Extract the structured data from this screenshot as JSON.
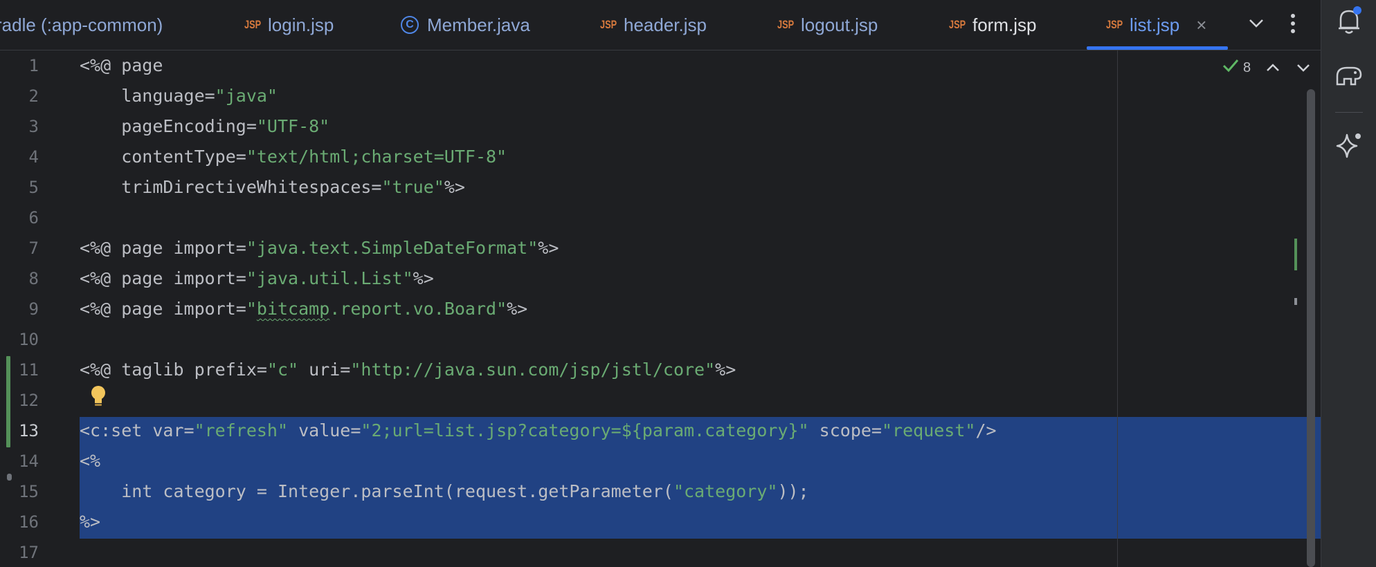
{
  "tabs": [
    {
      "name": "tab-app-common",
      "icon": "none",
      "label": "radle (:app-common)",
      "active": false
    },
    {
      "name": "tab-login-jsp",
      "icon": "jsp-file-icon",
      "label": "login.jsp",
      "active": false
    },
    {
      "name": "tab-member-java",
      "icon": "java-class-icon",
      "label": "Member.java",
      "active": false
    },
    {
      "name": "tab-header-jsp",
      "icon": "jsp-file-icon",
      "label": "header.jsp",
      "active": false
    },
    {
      "name": "tab-logout-jsp",
      "icon": "jsp-file-icon",
      "label": "logout.jsp",
      "active": false
    },
    {
      "name": "tab-form-jsp",
      "icon": "jsp-file-icon",
      "label": "form.jsp",
      "active": false
    },
    {
      "name": "tab-list-jsp",
      "icon": "jsp-file-icon",
      "label": "list.jsp",
      "active": true
    }
  ],
  "jsp_badge": "JSP",
  "java_badge": "C",
  "close_glyph": "×",
  "inspections": {
    "count": "8"
  },
  "line_numbers": [
    "1",
    "2",
    "3",
    "4",
    "5",
    "6",
    "7",
    "8",
    "9",
    "10",
    "11",
    "12",
    "13",
    "14",
    "15",
    "16",
    "17"
  ],
  "current_line": "13",
  "code": {
    "l1": [
      "<%@ page"
    ],
    "l2": [
      "    language=",
      "\"java\""
    ],
    "l3": [
      "    pageEncoding=",
      "\"UTF-8\""
    ],
    "l4": [
      "    contentType=",
      "\"text/html;charset=UTF-8\""
    ],
    "l5": [
      "    trimDirectiveWhitespaces=",
      "\"true\"",
      "%>"
    ],
    "l7": [
      "<%@ page import=",
      "\"java.text.SimpleDateFormat\"",
      "%>"
    ],
    "l8": [
      "<%@ page import=",
      "\"java.util.List\"",
      "%>"
    ],
    "l9": [
      "<%@ page import=",
      "\"",
      "bitcamp",
      ".report.vo.Board\"",
      "%>"
    ],
    "l11": [
      "<%@ taglib prefix=",
      "\"c\"",
      " uri=",
      "\"http://java.sun.com/jsp/jstl/core\"",
      "%>"
    ],
    "l13": [
      "<c:set var=",
      "\"refresh\"",
      " value=",
      "\"2;url=list.jsp?category=${param.category}\"",
      " scope=",
      "\"request\"",
      "/>"
    ],
    "l14": [
      "<%"
    ],
    "l15": [
      "    int category = Integer.parseInt(request.getParameter(",
      "\"category\"",
      "));"
    ],
    "l16": [
      "%>"
    ]
  },
  "colors": {
    "string": "#6aab73",
    "selection": "#214283",
    "accent": "#3574f0",
    "change_marker": "#549159"
  }
}
